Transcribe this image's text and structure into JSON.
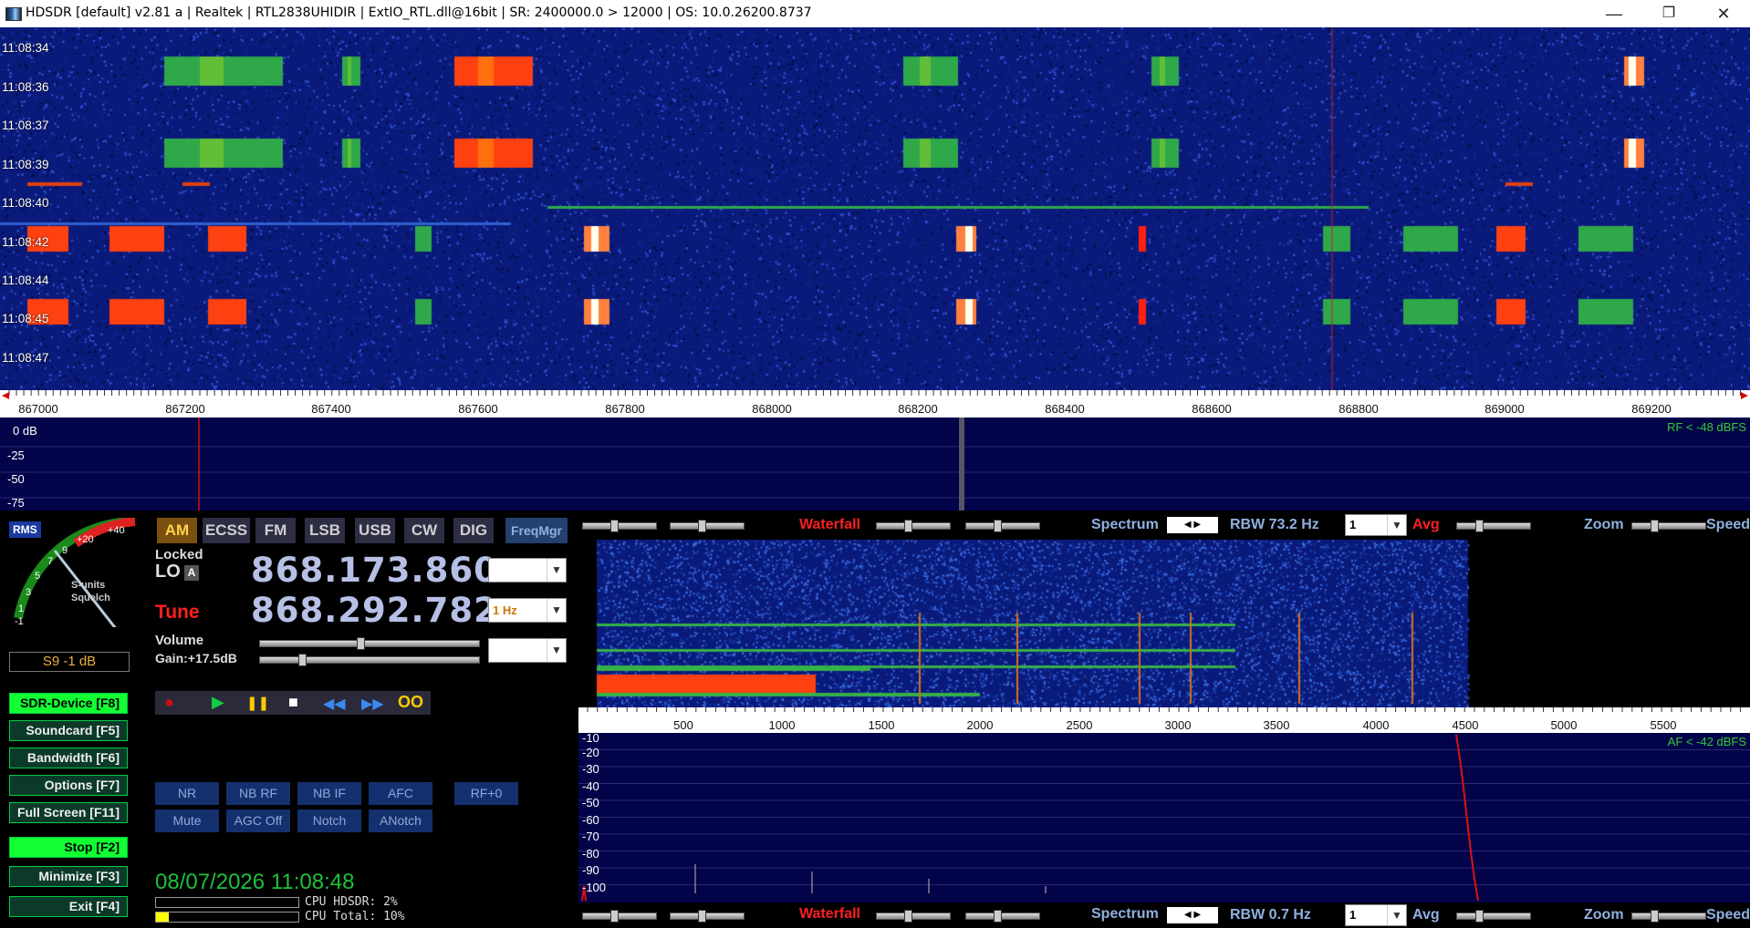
{
  "titlebar": {
    "title": "HDSDR  [default]  v2.81 a  |  Realtek | RTL2838UHIDIR | ExtIO_RTL.dll@16bit  |  SR: 2400000.0 > 12000  |  OS: 10.0.26200.8737",
    "minimize": "—",
    "restore": "❐",
    "close": "✕"
  },
  "waterfall_top": {
    "time_labels": [
      "11:08:34",
      "11:08:36",
      "11:08:37",
      "11:08:39",
      "11:08:40",
      "11:08:42",
      "11:08:44",
      "11:08:45",
      "11:08:47"
    ]
  },
  "freq_axis": {
    "labels": [
      "867000",
      "867200",
      "867400",
      "867600",
      "867800",
      "868000",
      "868200",
      "868400",
      "868600",
      "868800",
      "869000",
      "869200"
    ]
  },
  "rf_spectrum": {
    "db_labels": [
      "0 dB",
      "-25",
      "-50",
      "-75"
    ],
    "rf_level": "RF < -48 dBFS"
  },
  "smeter": {
    "rms": "RMS",
    "scale": [
      "-1",
      "1",
      "3",
      "5",
      "7",
      "9",
      "+20",
      "+40"
    ],
    "unit_label": "S-units",
    "squelch_label": "Squelch",
    "readout": "S9 -1 dB"
  },
  "modes": [
    "AM",
    "ECSS",
    "FM",
    "LSB",
    "USB",
    "CW",
    "DIG"
  ],
  "freqmgr": "FreqMgr",
  "lo": {
    "locked": "Locked",
    "label": "LO",
    "lock_badge": "A",
    "value": "868.173.860"
  },
  "tune": {
    "label": "Tune",
    "value": "868.292.782",
    "step": "1 Hz"
  },
  "volume": {
    "label": "Volume",
    "gain": "Gain:+17.5dB"
  },
  "nav_buttons": [
    {
      "label": "SDR-Device [F8]",
      "active": true
    },
    {
      "label": "Soundcard  [F5]",
      "active": false
    },
    {
      "label": "Bandwidth  [F6]",
      "active": false
    },
    {
      "label": "Options   [F7]",
      "active": false
    },
    {
      "label": "Full Screen [F11]",
      "active": false
    },
    {
      "label": "Stop      [F2]",
      "active": true
    },
    {
      "label": "Minimize  [F3]",
      "active": false
    },
    {
      "label": "Exit      [F4]",
      "active": false
    }
  ],
  "filters_row1": [
    "NR",
    "NB RF",
    "NB IF",
    "AFC",
    "RF+0"
  ],
  "filters_row2": [
    "Mute",
    "AGC Off",
    "Notch",
    "ANotch"
  ],
  "transport": {
    "record": "●",
    "play": "▶",
    "pause": "❚❚",
    "stop": "■",
    "rewind": "◀◀",
    "forward": "▶▶",
    "loop": "OO"
  },
  "status": {
    "datetime": "08/07/2026 11:08:48",
    "cpu_hdsdr": "CPU HDSDR:  2%",
    "cpu_total": "CPU Total: 10%"
  },
  "toolbar_top": {
    "waterfall": "Waterfall",
    "spectrum": "Spectrum",
    "rbw": "RBW 73.2 Hz",
    "avg_value": "1",
    "avg": "Avg",
    "zoom": "Zoom",
    "speed": "Speed"
  },
  "toolbar_bottom": {
    "waterfall": "Waterfall",
    "spectrum": "Spectrum",
    "rbw": "RBW  0.7 Hz",
    "avg_value": "1",
    "avg": "Avg",
    "zoom": "Zoom",
    "speed": "Speed"
  },
  "af_axis": {
    "labels": [
      "500",
      "1000",
      "1500",
      "2000",
      "2500",
      "3000",
      "3500",
      "4000",
      "4500",
      "5000",
      "5500"
    ]
  },
  "af_spectrum": {
    "db_labels": [
      "-10",
      "-20",
      "-30",
      "-40",
      "-50",
      "-60",
      "-70",
      "-80",
      "-90",
      "-100"
    ],
    "af_level": "AF < -42 dBFS"
  },
  "colors": {
    "waterfall_bg": "#0a1e8a",
    "signal_red": "#ff3a10",
    "signal_green": "#22c040",
    "spectrum_bg": "#03034a",
    "accent_red": "#ff2020",
    "accent_green": "#1f3"
  }
}
